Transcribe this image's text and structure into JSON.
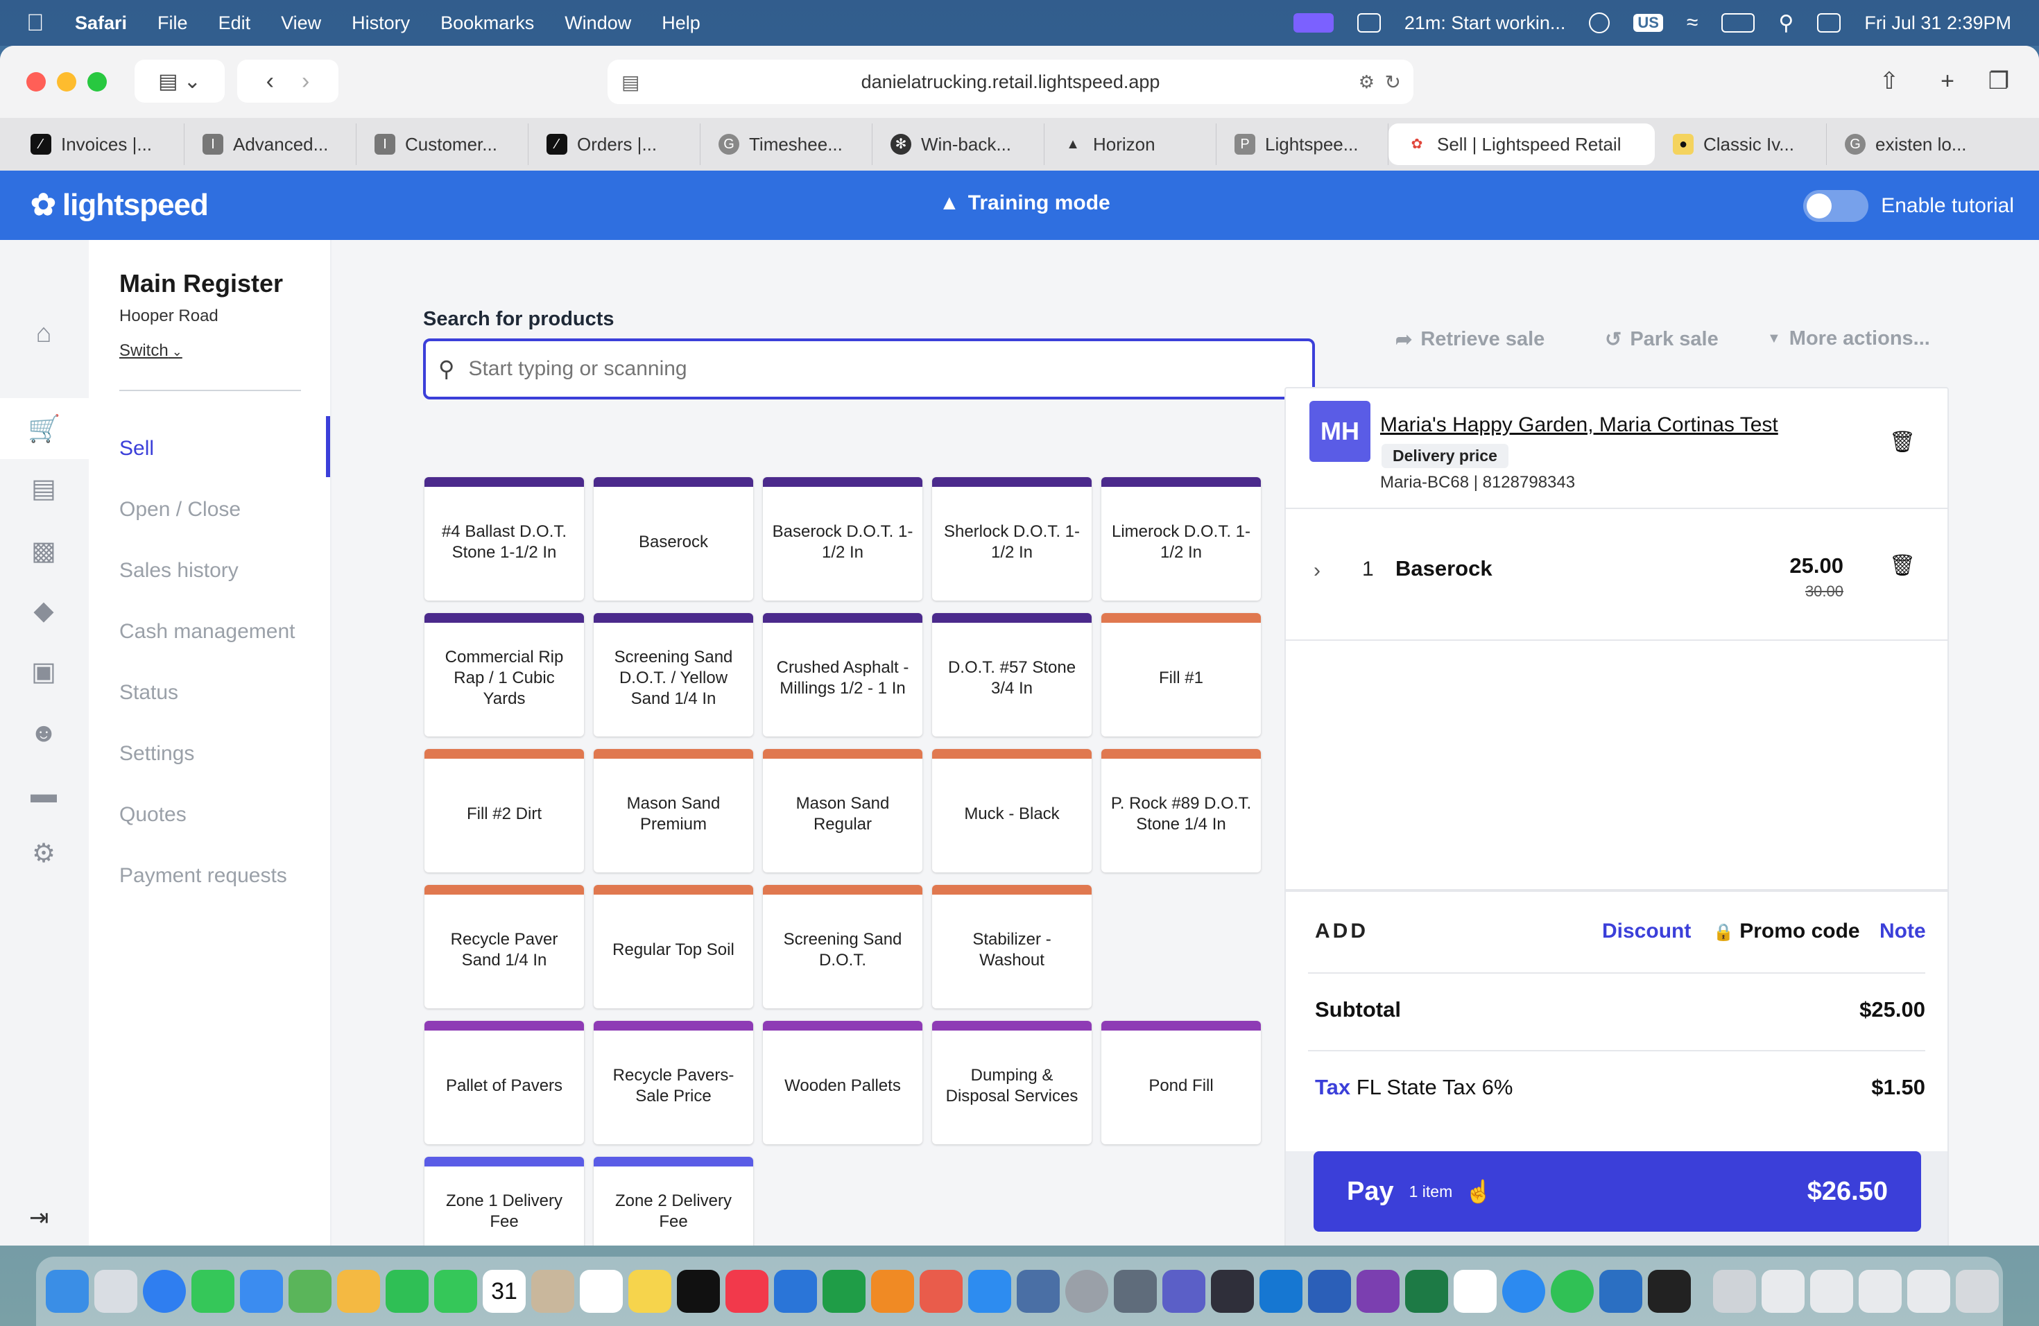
{
  "menubar": {
    "app": "Safari",
    "items": [
      "File",
      "Edit",
      "View",
      "History",
      "Bookmarks",
      "Window",
      "Help"
    ],
    "timer": "21m: Start workin...",
    "keyboard": "US",
    "datetime": "Fri Jul 31  2:39PM"
  },
  "browser": {
    "url": "danielatrucking.retail.lightspeed.app",
    "tabs": [
      {
        "label": "Invoices |..."
      },
      {
        "label": "Advanced..."
      },
      {
        "label": "Customer..."
      },
      {
        "label": "Orders |..."
      },
      {
        "label": "Timeshee..."
      },
      {
        "label": "Win-back..."
      },
      {
        "label": "Horizon"
      },
      {
        "label": "Lightspee..."
      },
      {
        "label": "Sell | Lightspeed Retail"
      },
      {
        "label": "Classic Iv..."
      },
      {
        "label": "existen lo..."
      }
    ]
  },
  "header": {
    "logo": "lightspeed",
    "training": "Training mode",
    "tutorial": "Enable tutorial"
  },
  "register": {
    "title": "Main Register",
    "location": "Hooper Road",
    "switch": "Switch"
  },
  "subnav": {
    "items": [
      "Sell",
      "Open / Close",
      "Sales history",
      "Cash management",
      "Status",
      "Settings",
      "Quotes",
      "Payment requests"
    ]
  },
  "search": {
    "label": "Search for products",
    "placeholder": "Start typing or scanning"
  },
  "actions": {
    "retrieve": "Retrieve sale",
    "park": "Park sale",
    "more": "More actions..."
  },
  "colors": {
    "purple": "#4b2a8c",
    "orange": "#e0784f",
    "violet": "#8e3bb5",
    "blue": "#5a5ce6",
    "accent": "#3b3fd9"
  },
  "products": [
    "#4 Ballast D.O.T. Stone 1-1/2 In",
    "Baserock",
    "Baserock D.O.T. 1-1/2 In",
    "Sherlock D.O.T. 1-1/2 In",
    "Limerock D.O.T. 1-1/2 In",
    "Commercial Rip Rap / 1 Cubic Yards",
    "Screening Sand D.O.T. / Yellow Sand 1/4 In",
    "Crushed Asphalt - Millings 1/2 - 1 In",
    "D.O.T. #57 Stone 3/4 In",
    "Fill #1",
    "Fill #2 Dirt",
    "Mason Sand Premium",
    "Mason Sand Regular",
    "Muck - Black",
    "P. Rock #89 D.O.T. Stone 1/4 In",
    "Recycle Paver Sand 1/4 In",
    "Regular Top Soil",
    "Screening Sand D.O.T.",
    "Stabilizer - Washout",
    "Pallet of Pavers",
    "Recycle Pavers- Sale Price",
    "Wooden Pallets",
    "Dumping & Disposal Services",
    "Pond Fill",
    "Zone 1 Delivery Fee",
    "Zone 2 Delivery Fee"
  ],
  "cart": {
    "initials": "MH",
    "customer": "Maria's Happy Garden, Maria Cortinas Test",
    "badge": "Delivery price",
    "meta": "Maria-BC68 | 8128798343",
    "line": {
      "qty": "1",
      "name": "Baserock",
      "price": "25.00",
      "old_price": "30.00"
    },
    "add": {
      "label": "ADD",
      "discount": "Discount",
      "promo": "Promo code",
      "note": "Note"
    },
    "subtotal": {
      "label": "Subtotal",
      "value": "$25.00"
    },
    "tax": {
      "link": "Tax",
      "label": "FL State Tax 6%",
      "value": "$1.50"
    },
    "pay": {
      "label": "Pay",
      "count": "1 item",
      "amount": "$26.50"
    }
  },
  "dock": {
    "calendar_day": "31"
  }
}
